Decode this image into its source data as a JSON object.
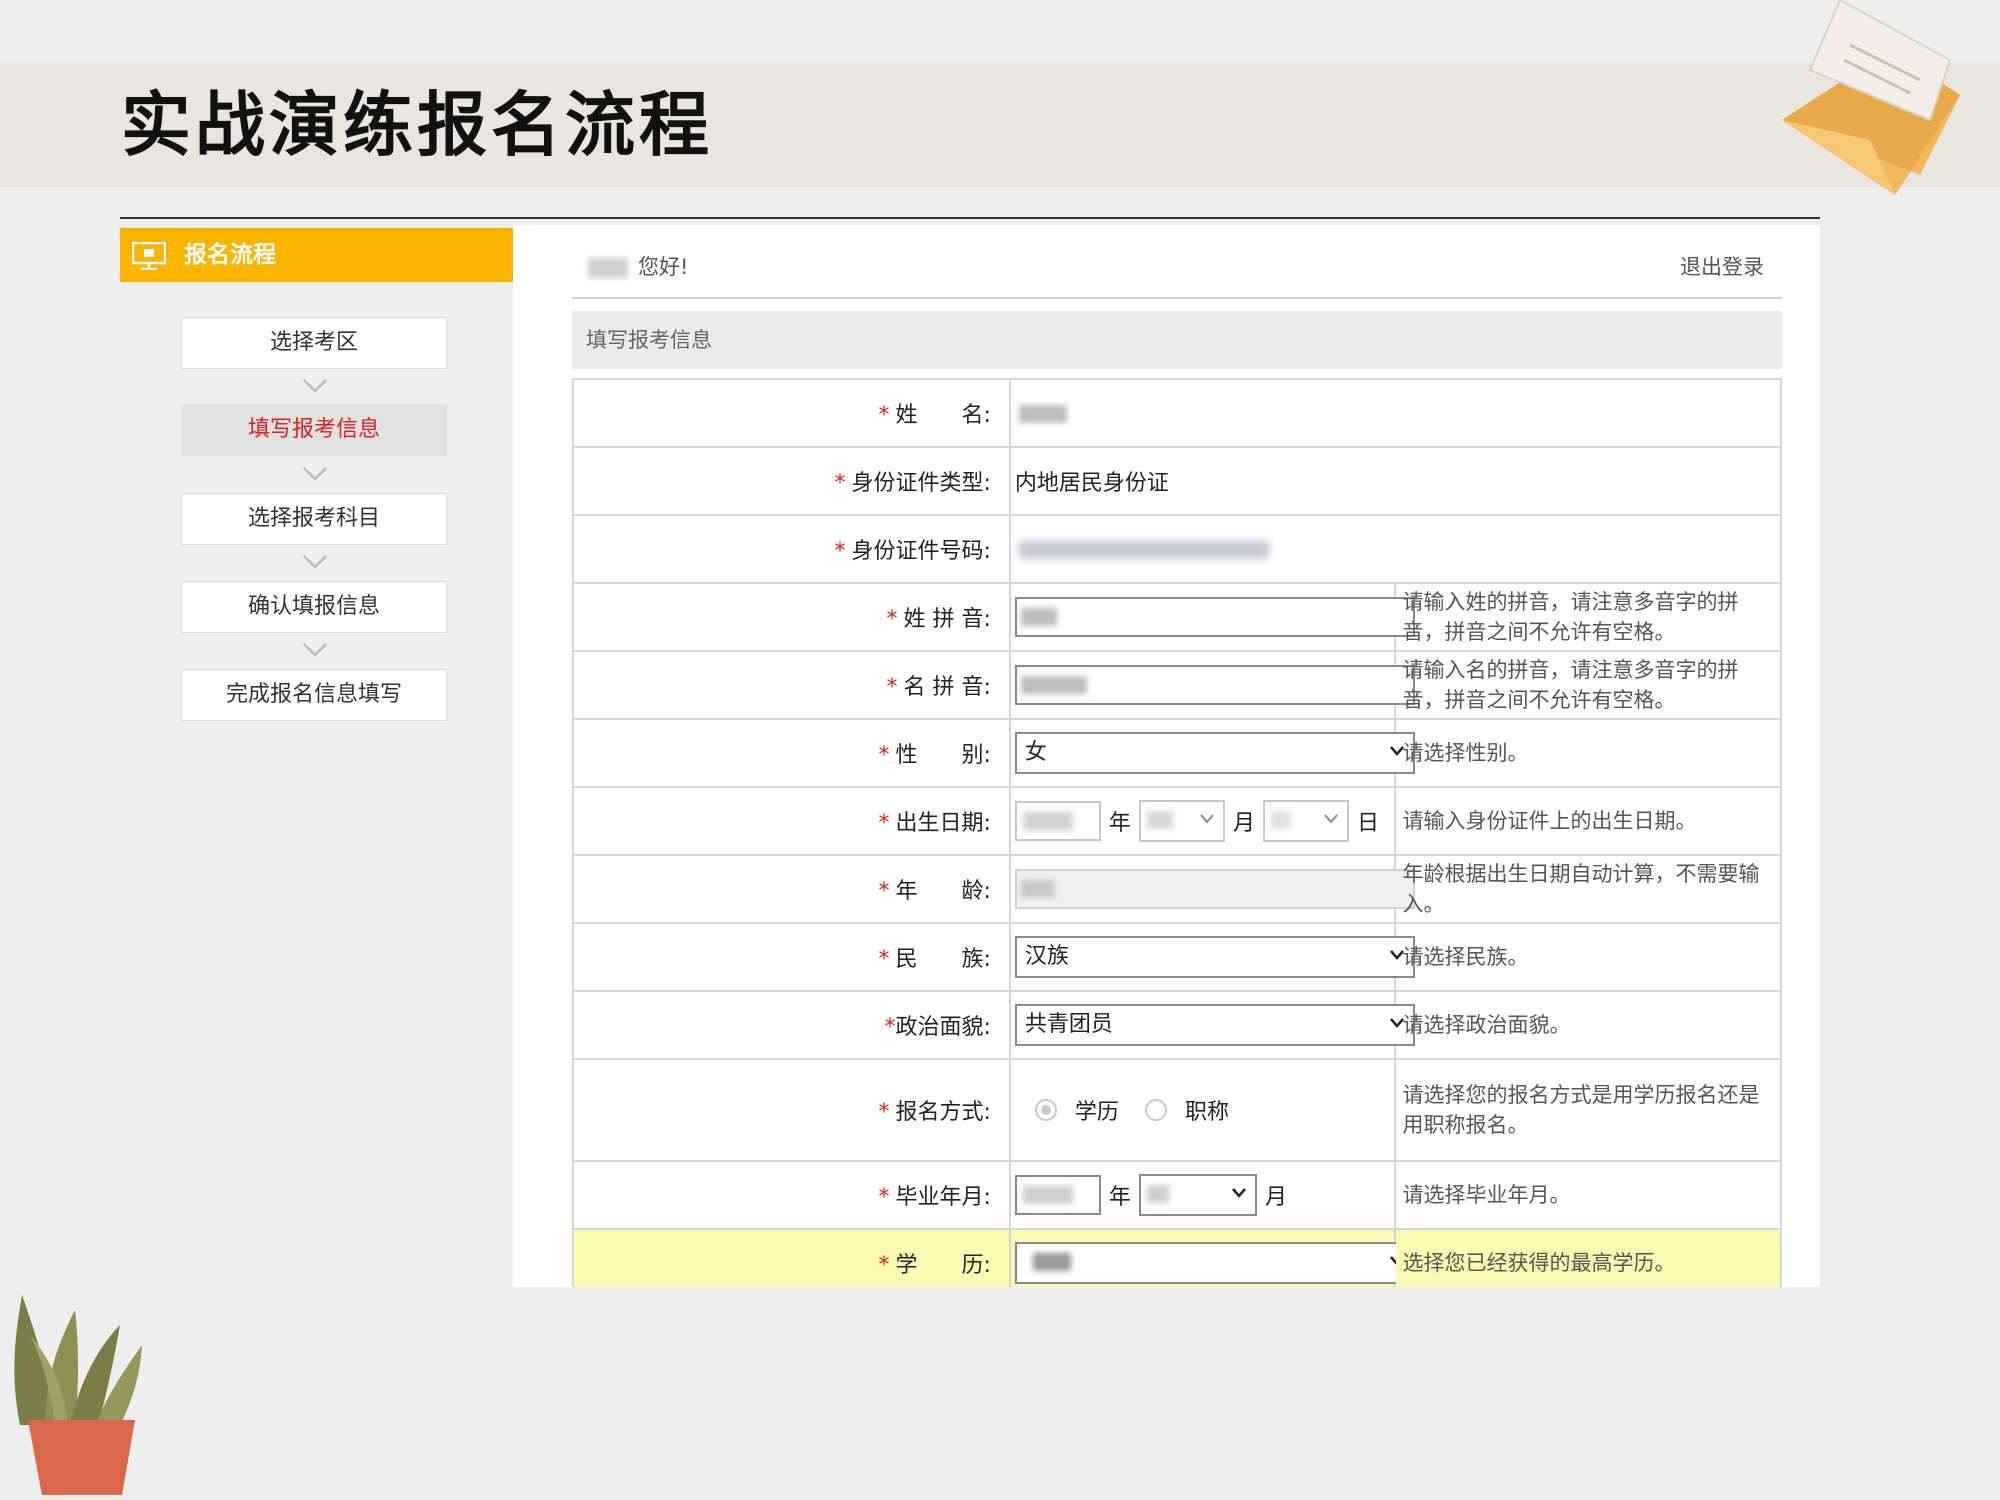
{
  "slide": {
    "title": "实战演练报名流程"
  },
  "sidebar": {
    "header": "报名流程",
    "steps": [
      {
        "label": "选择考区",
        "active": false
      },
      {
        "label": "填写报考信息",
        "active": true
      },
      {
        "label": "选择报考科目",
        "active": false
      },
      {
        "label": "确认填报信息",
        "active": false
      },
      {
        "label": "完成报名信息填写",
        "active": false
      }
    ]
  },
  "header": {
    "greeting": "您好!",
    "logout": "退出登录"
  },
  "section": {
    "title": "填写报考信息"
  },
  "form": {
    "required_mark": "*",
    "name_label": "姓　　名:",
    "id_type_label": "身份证件类型:",
    "id_type_value": "内地居民身份证",
    "id_number_label": "身份证件号码:",
    "surname_pinyin_label": "姓 拼 音:",
    "surname_pinyin_hint": "请输入姓的拼音，请注意多音字的拼音，拼音之间不允许有空格。",
    "given_pinyin_label": "名 拼 音:",
    "given_pinyin_hint": "请输入名的拼音，请注意多音字的拼音，拼音之间不允许有空格。",
    "gender_label": "性　　别:",
    "gender_value": "女",
    "gender_hint": "请选择性别。",
    "birth_label": "出生日期:",
    "year_unit": "年",
    "month_unit": "月",
    "day_unit": "日",
    "birth_hint": "请输入身份证件上的出生日期。",
    "age_label": "年　　龄:",
    "age_hint": "年龄根据出生日期自动计算，不需要输入。",
    "ethnicity_label": "民　　族:",
    "ethnicity_value": "汉族",
    "ethnicity_hint": "请选择民族。",
    "political_label": "政治面貌:",
    "political_value": "共青团员",
    "political_hint": "请选择政治面貌。",
    "method_label": "报名方式:",
    "method_option_1": "学历",
    "method_option_2": "职称",
    "method_hint": "请选择您的报名方式是用学历报名还是用职称报名。",
    "grad_label": "毕业年月:",
    "grad_hint": "请选择毕业年月。",
    "edu_label": "学　　历:",
    "edu_hint": "选择您已经获得的最高学历。"
  },
  "colors": {
    "accent": "#fbb400",
    "active_step": "#e02020",
    "highlight_row": "#fbf8b2"
  }
}
